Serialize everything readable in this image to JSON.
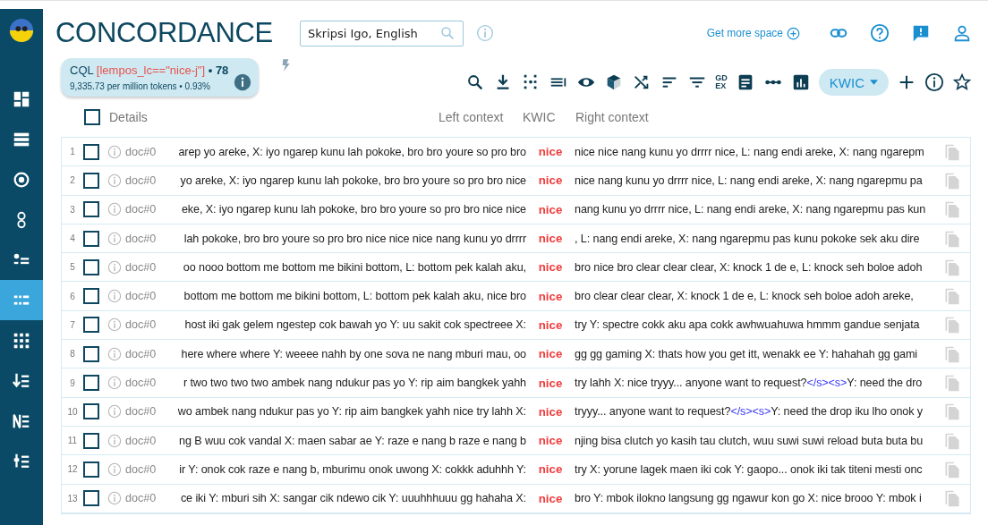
{
  "sidebar": {
    "items": [
      {
        "selected": false
      },
      {
        "selected": false
      },
      {
        "selected": false
      },
      {
        "selected": false
      },
      {
        "selected": false
      },
      {
        "selected": true
      },
      {
        "selected": false
      },
      {
        "selected": false
      },
      {
        "selected": false
      },
      {
        "selected": false
      }
    ]
  },
  "header": {
    "title": "CONCORDANCE",
    "corpus": {
      "value": "Skripsi Igo, English"
    },
    "get_more_space": "Get more space"
  },
  "query": {
    "prefix": "CQL",
    "expression": "[lempos_lc==\"nice-j\"]",
    "hits": "• 78",
    "frequency": "9,335.73 per million tokens • 0.93%"
  },
  "toolbar": {
    "gdex": [
      "GD",
      "EX"
    ],
    "view_mode": "KWIC"
  },
  "table": {
    "columns": [
      "Details",
      "Left context",
      "KWIC",
      "Right context"
    ],
    "select_all": {
      "checked": false
    },
    "rows": [
      {
        "number": "1",
        "checked": false,
        "doc": "doc#0",
        "left": "arep yo areke, X: iyo ngarep kunu lah pokoke, bro bro youre so pro bro",
        "kwic": "nice",
        "right": [
          {
            "text": "nice nice nang kunu yo drrrr nice, L: nang endi areke, X: nang ngarepm",
            "tag": false
          }
        ]
      },
      {
        "number": "2",
        "checked": false,
        "doc": "doc#0",
        "left": "yo areke, X: iyo ngarep kunu lah pokoke, bro bro youre so pro bro nice",
        "kwic": "nice",
        "right": [
          {
            "text": "nice nang kunu yo drrrr nice, L: nang endi areke, X: nang ngarepmu pa",
            "tag": false
          }
        ]
      },
      {
        "number": "3",
        "checked": false,
        "doc": "doc#0",
        "left": "eke, X: iyo ngarep kunu lah pokoke, bro bro youre so pro bro nice nice",
        "kwic": "nice",
        "right": [
          {
            "text": "nang kunu yo drrrr nice, L: nang endi areke, X: nang ngarepmu pas kun",
            "tag": false
          }
        ]
      },
      {
        "number": "4",
        "checked": false,
        "doc": "doc#0",
        "left": "lah pokoke, bro bro youre so pro bro nice nice nice nang kunu yo drrrr",
        "kwic": "nice",
        "right": [
          {
            "text": ", L: nang endi areke, X: nang ngarepmu pas kunu pokoke sek aku dire",
            "tag": false
          }
        ]
      },
      {
        "number": "5",
        "checked": false,
        "doc": "doc#0",
        "left": "oo nooo bottom me bottom me bikini bottom, L: bottom pek kalah aku,",
        "kwic": "nice",
        "right": [
          {
            "text": "bro nice bro clear clear clear, X: knock 1 de e, L: knock seh boloe adoh",
            "tag": false
          }
        ]
      },
      {
        "number": "6",
        "checked": false,
        "doc": "doc#0",
        "left": "bottom me bottom me bikini bottom, L: bottom pek kalah aku, nice bro",
        "kwic": "nice",
        "right": [
          {
            "text": "bro clear clear clear, X: knock 1 de e, L: knock seh boloe adoh areke,",
            "tag": false
          }
        ]
      },
      {
        "number": "7",
        "checked": false,
        "doc": "doc#0",
        "left": "host iki gak gelem ngestep cok bawah yo Y: uu sakit cok spectreee X:",
        "kwic": "nice",
        "right": [
          {
            "text": "try Y: spectre cokk aku apa cokk awhwuahuwa hmmm gandue senjata",
            "tag": false
          }
        ]
      },
      {
        "number": "8",
        "checked": false,
        "doc": "doc#0",
        "left": "here where where Y: weeee nahh by one sova ne nang mburi mau, oo",
        "kwic": "nice",
        "right": [
          {
            "text": "gg gg gaming X: thats how you get itt, wenakk ee Y: hahahah gg gami",
            "tag": false
          }
        ]
      },
      {
        "number": "9",
        "checked": false,
        "doc": "doc#0",
        "left": "r two two two two ambek nang ndukur pas yo Y: rip aim bangkek yahh",
        "kwic": "nice",
        "right": [
          {
            "text": "try lahh X: nice tryyy... anyone want to request?",
            "tag": false
          },
          {
            "text": "</s><s>",
            "tag": true
          },
          {
            "text": "Y: need the dro",
            "tag": false
          }
        ]
      },
      {
        "number": "10",
        "checked": false,
        "doc": "doc#0",
        "left": "wo ambek nang ndukur pas yo Y: rip aim bangkek yahh nice try lahh X:",
        "kwic": "nice",
        "right": [
          {
            "text": "tryyy... anyone want to request?",
            "tag": false
          },
          {
            "text": "</s><s>",
            "tag": true
          },
          {
            "text": "Y: need the drop iku lho onok y",
            "tag": false
          }
        ]
      },
      {
        "number": "11",
        "checked": false,
        "doc": "doc#0",
        "left": "ng B wuu cok vandal X: maen sabar ae Y: raze e nang b raze e nang b",
        "kwic": "nice",
        "right": [
          {
            "text": "njing bisa clutch yo kasih tau clutch, wuu suwi suwi reload buta buta bu",
            "tag": false
          }
        ]
      },
      {
        "number": "12",
        "checked": false,
        "doc": "doc#0",
        "left": "ir Y: onok cok raze e nang b, mburimu onok uwong X: cokkk aduhhh Y:",
        "kwic": "nice",
        "right": [
          {
            "text": "try X: yorune lagek maen iki cok Y: gaopo... onok iki tak titeni mesti onc",
            "tag": false
          }
        ]
      },
      {
        "number": "13",
        "checked": false,
        "doc": "doc#0",
        "left": "ce iki Y: mburi sih X: sangar cik ndewo cik Y: uuuhhhuuu gg hahaha X:",
        "kwic": "nice",
        "right": [
          {
            "text": "bro Y: mbok ilokno langsung gg ngawur kon go X: nice brooo Y: mbok i",
            "tag": false
          }
        ]
      }
    ]
  }
}
